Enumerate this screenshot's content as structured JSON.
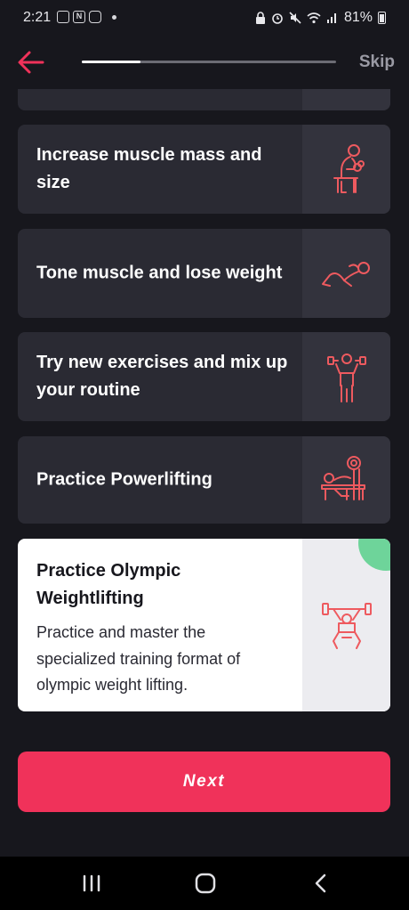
{
  "status_bar": {
    "time": "2:21",
    "battery": "81%",
    "left_icons": [
      "gallery-icon",
      "notion-icon",
      "instagram-icon",
      "notification-dot"
    ],
    "right_icons": [
      "lock-icon",
      "alarm-icon",
      "mute-icon",
      "wifi-icon",
      "signal-icon",
      "battery-icon"
    ]
  },
  "header": {
    "skip_label": "Skip",
    "progress": 0.23,
    "back_icon": "arrow-left-icon"
  },
  "goals": [
    {
      "label": "Increase muscle mass and size",
      "icon": "seated-dumbbell-curl-icon"
    },
    {
      "label": "Tone muscle and lose weight",
      "icon": "crunches-icon"
    },
    {
      "label": "Try new exercises and mix up your routine",
      "icon": "dumbbell-press-icon"
    },
    {
      "label": "Practice Powerlifting",
      "icon": "bench-press-icon"
    }
  ],
  "selected_goal": {
    "title": "Practice Olympic Weightlifting",
    "description": "Practice and master the specialized training format of olympic weight lifting.",
    "icon": "overhead-barbell-icon",
    "selected": true
  },
  "next_button": {
    "label": "Next"
  },
  "colors": {
    "accent": "#f0325a",
    "icon_stroke": "#ee5a5f",
    "check_badge": "#6ed49a",
    "card_bg": "#2a2a33",
    "page_bg": "#17171d"
  },
  "nav_bar": {
    "items": [
      "recents-icon",
      "home-icon",
      "back-icon"
    ]
  }
}
